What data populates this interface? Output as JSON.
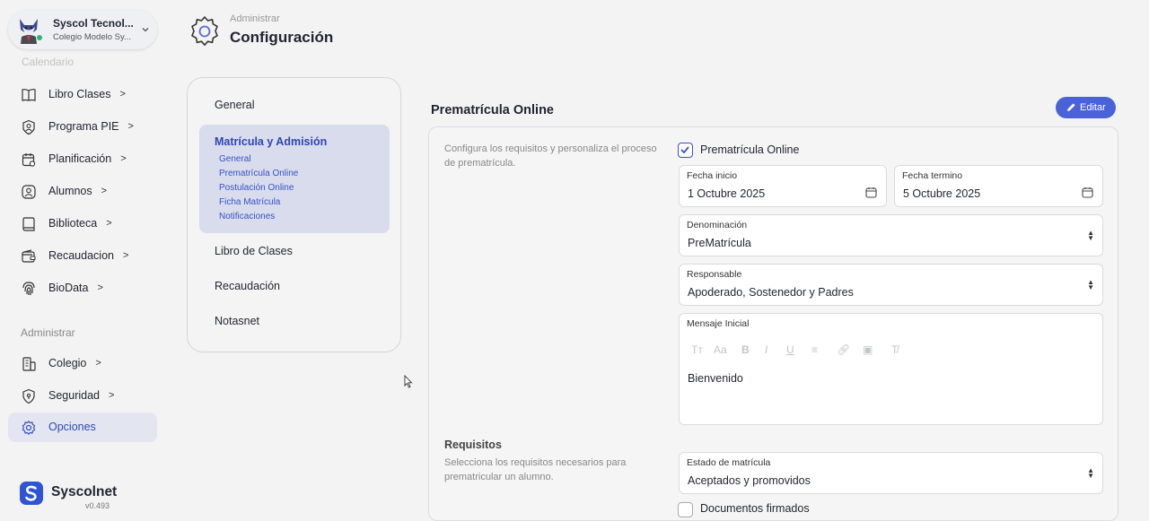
{
  "org": {
    "name": "Syscol Tecnol...",
    "subtitle": "Colegio Modelo Sy..."
  },
  "sidebar": {
    "faded_item": "Calendario",
    "items": [
      {
        "label": "Libro Clases",
        "icon": "book-icon"
      },
      {
        "label": "Programa PIE",
        "icon": "person-badge-icon"
      },
      {
        "label": "Planificación",
        "icon": "calendar-plan-icon"
      },
      {
        "label": "Alumnos",
        "icon": "student-icon"
      },
      {
        "label": "Biblioteca",
        "icon": "library-icon"
      },
      {
        "label": "Recaudacion",
        "icon": "wallet-icon"
      },
      {
        "label": "BioData",
        "icon": "fingerprint-icon"
      }
    ],
    "admin_heading": "Administrar",
    "admin_items": [
      {
        "label": "Colegio",
        "icon": "building-icon"
      },
      {
        "label": "Seguridad",
        "icon": "shield-icon"
      },
      {
        "label": "Opciones",
        "icon": "gear-icon",
        "active": true
      }
    ],
    "brand": {
      "name": "Syscolnet",
      "version": "v0.493"
    }
  },
  "header": {
    "super": "Administrar",
    "title": "Configuración"
  },
  "settings_nav": {
    "general": "General",
    "active_title": "Matrícula y Admisión",
    "sub_links": [
      "General",
      "Prematrícula Online",
      "Postulación Online",
      "Ficha Matrícula",
      "Notificaciones"
    ],
    "libro": "Libro de Clases",
    "recaudacion": "Recaudación",
    "notasnet": "Notasnet"
  },
  "panel": {
    "title": "Prematrícula Online",
    "edit_label": "Editar",
    "description": "Configura los requisitos y personaliza el proceso de prematrícula.",
    "checkbox_label": "Prematrícula Online",
    "checkbox_checked": true,
    "fecha_inicio": {
      "label": "Fecha inicio",
      "value": "1 Octubre 2025"
    },
    "fecha_termino": {
      "label": "Fecha termino",
      "value": "5 Octubre 2025"
    },
    "denominacion": {
      "label": "Denominación",
      "value": "PreMatrícula"
    },
    "responsable": {
      "label": "Responsable",
      "value": "Apoderado, Sostenedor y Padres"
    },
    "mensaje": {
      "label": "Mensaje Inicial",
      "value": "Bienvenido"
    },
    "requisitos": {
      "title": "Requisitos",
      "description": "Selecciona los requisitos necesarios para prematricular un alumno.",
      "estado": {
        "label": "Estado de matrícula",
        "value": "Aceptados y promovidos"
      },
      "documentos_label": "Documentos firmados"
    }
  },
  "colors": {
    "accent": "#3a52c4",
    "button": "#4a62d8",
    "active_bg": "#d8dced"
  }
}
